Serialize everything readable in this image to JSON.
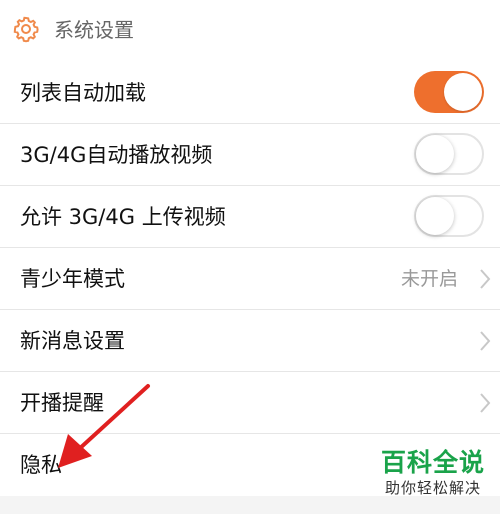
{
  "header": {
    "title": "系统设置",
    "icon": "gear-icon"
  },
  "rows": [
    {
      "label": "列表自动加载",
      "control": "toggle",
      "on": true
    },
    {
      "label": "3G/4G自动播放视频",
      "control": "toggle",
      "on": false
    },
    {
      "label": "允许 3G/4G 上传视频",
      "control": "toggle",
      "on": false
    },
    {
      "label": "青少年模式",
      "control": "chevron",
      "value": "未开启"
    },
    {
      "label": "新消息设置",
      "control": "chevron"
    },
    {
      "label": "开播提醒",
      "control": "chevron"
    },
    {
      "label": "隐私",
      "control": "none"
    }
  ],
  "colors": {
    "accent": "#ee6f2d",
    "watermark": "#1aa34a"
  },
  "watermark": {
    "title": "百科全说",
    "subtitle": "助你轻松解决"
  }
}
